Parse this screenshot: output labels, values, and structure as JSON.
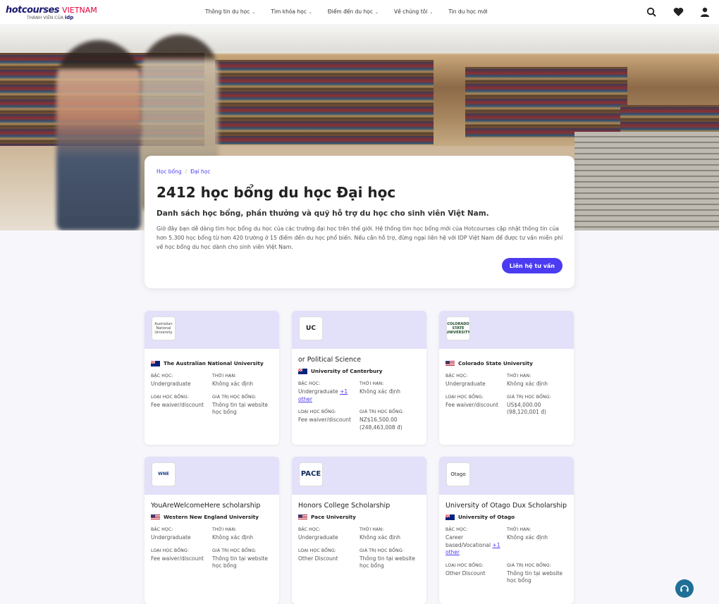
{
  "header": {
    "logo_main": "hotcourses",
    "logo_country": "VIETNAM",
    "logo_sub": "THÀNH VIÊN CỦA",
    "logo_idp": "idp",
    "nav": [
      {
        "label": "Thông tin du học"
      },
      {
        "label": "Tìm khóa học"
      },
      {
        "label": "Điểm đến du học"
      },
      {
        "label": "Về chúng tôi"
      },
      {
        "label": "Tin du học mới"
      }
    ]
  },
  "hero_card": {
    "breadcrumb": [
      "Học bổng",
      "Đại học"
    ],
    "title": "2412 học bổng du học Đại học",
    "subtitle": "Danh sách học bổng, phần thưởng và quỹ hỗ trợ du học cho sinh viên Việt Nam.",
    "description": "Giờ đây bạn dễ dàng tìm học bổng du học của các trường đại học trên thế giới. Hệ thống tìm học bổng mới của Hotcourses cập nhật thông tin của hơn 5.300 học bổng từ hơn 420 trường ở 15 điểm đến du học phổ biến. Nếu cần hỗ trợ, đừng ngại liên hệ với IDP Việt Nam để được tư vấn miễn phí về học bổng du học dành cho sinh viên Việt Nam.",
    "cta": "Liên hệ tư vấn"
  },
  "labels": {
    "level": "BẬC HỌC:",
    "deadline": "THỜI HẠN:",
    "type": "LOẠI HỌC BỔNG:",
    "value": "GIÁ TRỊ HỌC BỔNG:"
  },
  "scholarships": [
    {
      "logo": "Australian National University",
      "title": "",
      "university": "The Australian National University",
      "flag": "au",
      "level": "Undergraduate",
      "level_more": "",
      "deadline": "Không xác định",
      "type": "Fee waiver/discount",
      "value": "Thông tin tại website học bổng"
    },
    {
      "logo": "UC",
      "title": "or Political Science",
      "university": "University of Canterbury",
      "flag": "nz",
      "level": "Undergraduate",
      "level_more": "+1 other",
      "deadline": "Không xác định",
      "type": "Fee waiver/discount",
      "value": "NZ$16,500.00 (248,463,008 đ)"
    },
    {
      "logo": "COLORADO STATE UNIVERSITY",
      "title": "",
      "university": "Colorado State University",
      "flag": "us",
      "level": "Undergraduate",
      "level_more": "",
      "deadline": "Không xác định",
      "type": "Fee waiver/discount",
      "value": "US$4,000.00 (98,120,001 đ)"
    },
    {
      "logo": "WNE",
      "title": "YouAreWelcomeHere scholarship",
      "university": "Western New England University",
      "flag": "us",
      "level": "Undergraduate",
      "level_more": "",
      "deadline": "Không xác định",
      "type": "Fee waiver/discount",
      "value": "Thông tin tại website học bổng"
    },
    {
      "logo": "PACE",
      "title": "Honors College Scholarship",
      "university": "Pace University",
      "flag": "us",
      "level": "Undergraduate",
      "level_more": "",
      "deadline": "Không xác định",
      "type": "Other Discount",
      "value": "Thông tin tại website học bổng"
    },
    {
      "logo": "Otago",
      "title": "University of Otago Dux Scholarship",
      "university": "University of Otago",
      "flag": "nz",
      "level": "Career based/Vocational",
      "level_more": "+1 other",
      "deadline": "Không xác định",
      "type": "Other Discount",
      "value": "Thông tin tại website học bổng"
    }
  ]
}
